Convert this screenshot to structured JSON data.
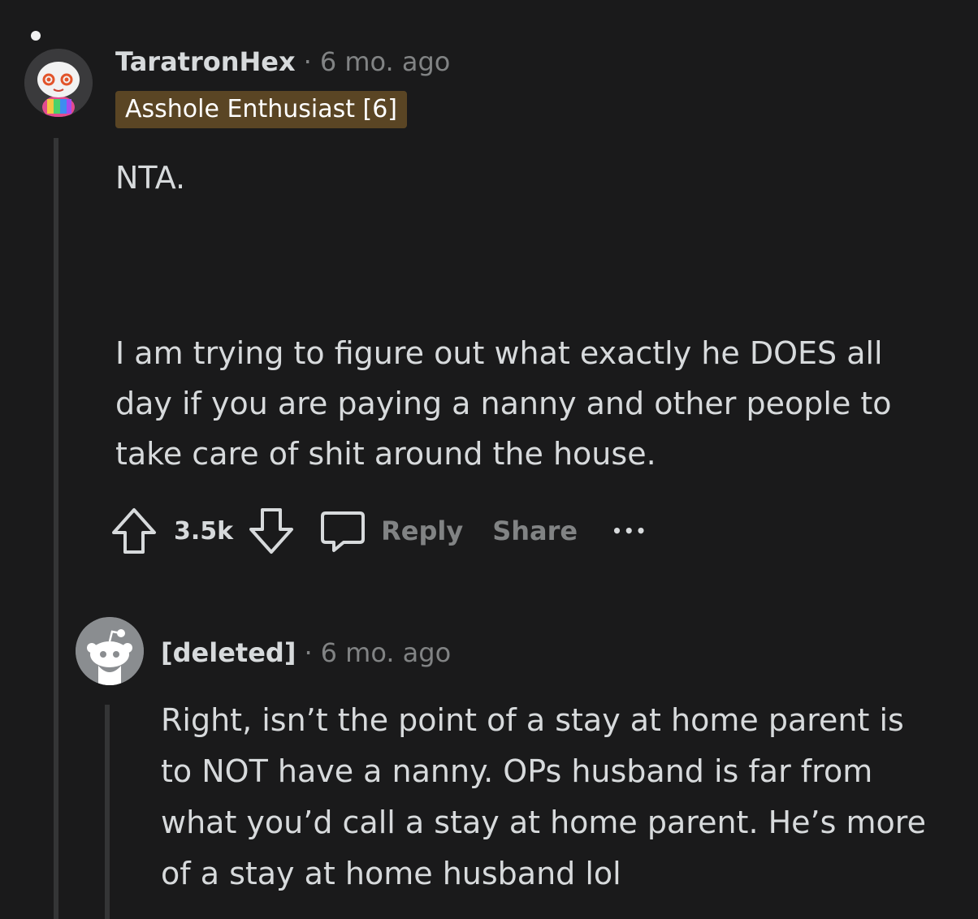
{
  "comment": {
    "username": "TaratronHex",
    "separator": "·",
    "time": "6 mo. ago",
    "flair": "Asshole Enthusiast [6]",
    "paragraphs": [
      "NTA.",
      "I am trying to figure out what exactly he DOES all day if you are paying a nanny and other people to take care of shit around the house."
    ],
    "votes": "3.5k",
    "reply_label": "Reply",
    "share_label": "Share",
    "more_label": "•••"
  },
  "reply": {
    "username": "[deleted]",
    "separator": "·",
    "time": "6 mo. ago",
    "text": "Right, isn’t the point of a stay at home parent is to NOT have a nanny. OPs husband is far from what you’d call a stay at home parent. He’s more of a stay at home husband lol"
  },
  "colors": {
    "background": "#1a1a1b",
    "text": "#d7dadc",
    "meta": "#818384",
    "flair_bg": "#5a4524",
    "thread_line": "#343536"
  },
  "icons": [
    "snoo-avatar-icon",
    "deleted-avatar-icon",
    "upvote-icon",
    "downvote-icon",
    "comment-icon",
    "more-icon"
  ]
}
